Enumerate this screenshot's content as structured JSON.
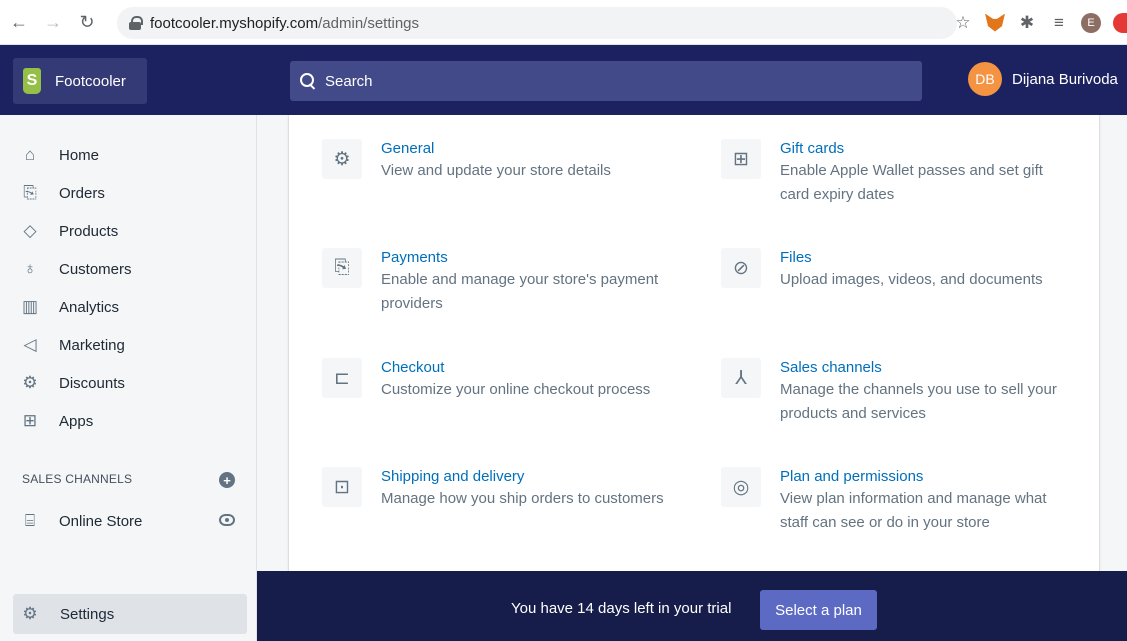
{
  "browser": {
    "url_domain": "footcooler.myshopify.com",
    "url_path": "/admin/settings",
    "extension_e": "E"
  },
  "topbar": {
    "store_name": "Footcooler",
    "logo_letter": "S",
    "search_label": "Search",
    "user_initials": "DB",
    "user_name": "Dijana Burivoda"
  },
  "sidebar": {
    "items": [
      {
        "label": "Home",
        "icon": "home-icon"
      },
      {
        "label": "Orders",
        "icon": "orders-icon"
      },
      {
        "label": "Products",
        "icon": "tag-icon"
      },
      {
        "label": "Customers",
        "icon": "person-icon"
      },
      {
        "label": "Analytics",
        "icon": "bar-chart-icon"
      },
      {
        "label": "Marketing",
        "icon": "megaphone-icon"
      },
      {
        "label": "Discounts",
        "icon": "discount-icon"
      },
      {
        "label": "Apps",
        "icon": "apps-icon"
      }
    ],
    "sales_channels_label": "SALES CHANNELS",
    "online_store_label": "Online Store",
    "settings_label": "Settings"
  },
  "settings": {
    "tiles": [
      {
        "title": "General",
        "desc": "View and update your store details",
        "icon": "gear-icon"
      },
      {
        "title": "Gift cards",
        "desc": "Enable Apple Wallet passes and set gift card expiry dates",
        "icon": "gift-icon"
      },
      {
        "title": "Payments",
        "desc": "Enable and manage your store's payment providers",
        "icon": "payment-icon"
      },
      {
        "title": "Files",
        "desc": "Upload images, videos, and documents",
        "icon": "paperclip-icon"
      },
      {
        "title": "Checkout",
        "desc": "Customize your online checkout process",
        "icon": "cart-icon"
      },
      {
        "title": "Sales channels",
        "desc": "Manage the channels you use to sell your products and services",
        "icon": "channels-icon"
      },
      {
        "title": "Shipping and delivery",
        "desc": "Manage how you ship orders to customers",
        "icon": "truck-icon"
      },
      {
        "title": "Plan and permissions",
        "desc": "View plan information and manage what staff can see or do in your store",
        "icon": "plan-icon"
      }
    ]
  },
  "trial": {
    "message": "You have 14 days left in your trial",
    "button_label": "Select a plan"
  },
  "colors": {
    "topbar": "#1c2260",
    "link": "#006fbb",
    "trial_bar": "#171d4a",
    "plan_button": "#5c6ac4",
    "avatar": "#f49342"
  }
}
